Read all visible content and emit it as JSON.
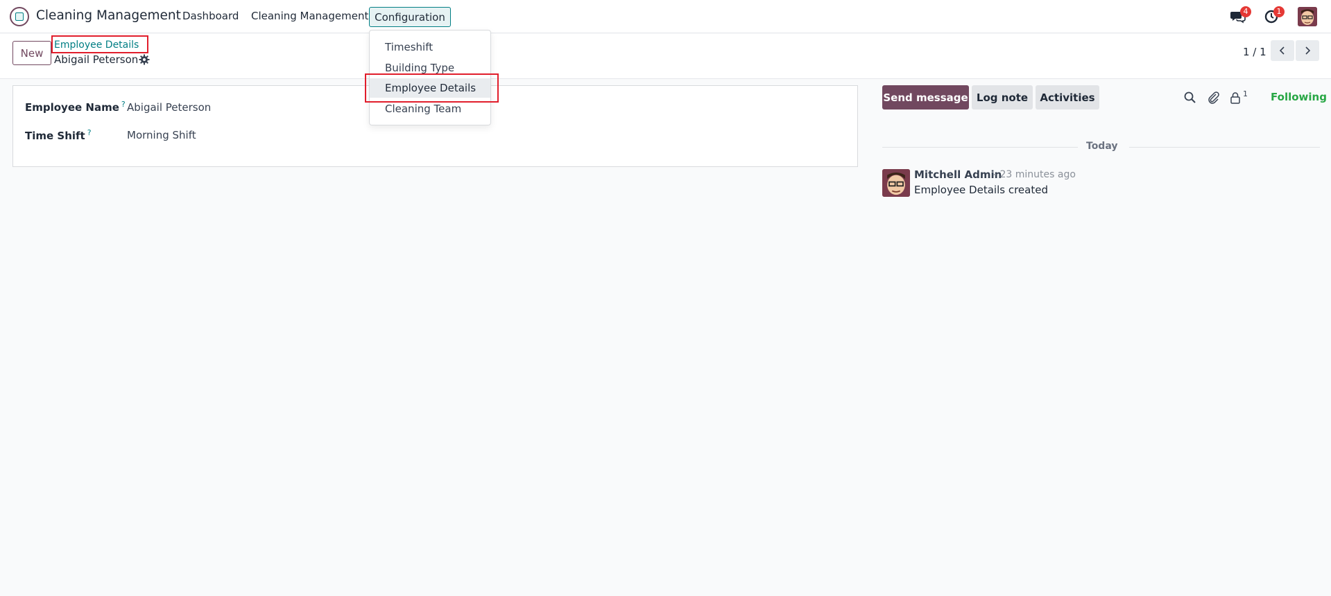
{
  "navbar": {
    "app_title": "Cleaning Management",
    "menu": [
      "Dashboard",
      "Cleaning Management",
      "Configuration"
    ],
    "messages_badge": "4",
    "activities_badge": "1"
  },
  "control_panel": {
    "new_label": "New",
    "breadcrumb_parent": "Employee Details",
    "record_name": "Abigail Peterson",
    "pager": "1 / 1"
  },
  "form": {
    "fields": [
      {
        "label": "Employee Name",
        "help": "?",
        "value": "Abigail Peterson"
      },
      {
        "label": "Time Shift",
        "help": "?",
        "value": "Morning Shift"
      }
    ]
  },
  "dropdown": {
    "items": [
      "Timeshift",
      "Building Type",
      "Employee Details",
      "Cleaning Team"
    ],
    "active_index": 2
  },
  "chatter": {
    "send_message": "Send message",
    "log_note": "Log note",
    "activities": "Activities",
    "followers_count": "1",
    "following": "Following",
    "date_separator": "Today",
    "messages": [
      {
        "author": "Mitchell Admin",
        "time": "- 23 minutes ago",
        "body": "Employee Details created"
      }
    ]
  },
  "colors": {
    "brand": "#71485f",
    "accent": "#017e84",
    "following": "#28a745",
    "highlight_box": "#e11d2b",
    "badge": "#e53935"
  }
}
